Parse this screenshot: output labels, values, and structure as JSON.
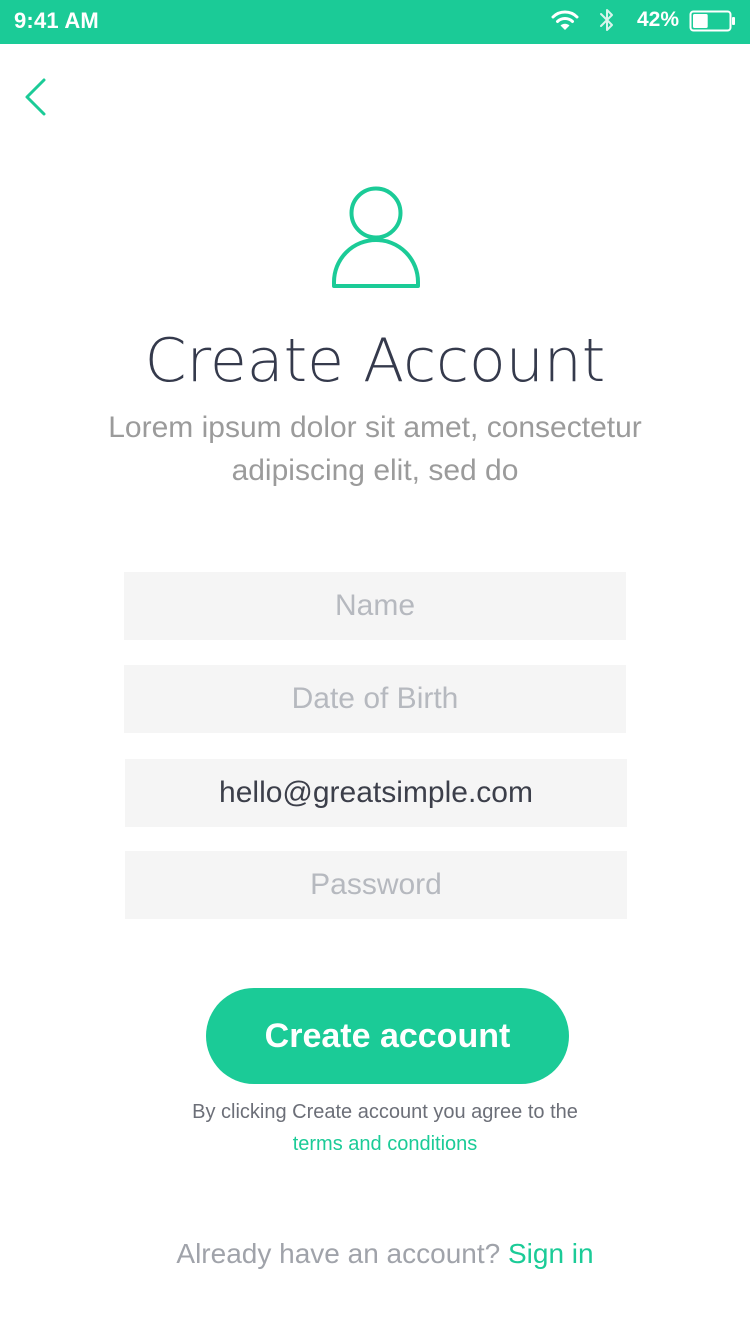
{
  "status_bar": {
    "time": "9:41 AM",
    "battery_percent": "42%",
    "battery_level": 0.42,
    "icons": [
      "wifi-icon",
      "bluetooth-icon",
      "battery-icon"
    ],
    "background_color": "#1bcb97"
  },
  "header": {
    "back_icon": "chevron-left-icon"
  },
  "hero": {
    "icon": "user-icon",
    "title": "Create Account",
    "subtitle": "Lorem ipsum dolor sit amet, consectetur adipiscing elit, sed do"
  },
  "form": {
    "name": {
      "placeholder": "Name",
      "value": ""
    },
    "date_of_birth": {
      "placeholder": "Date of Birth",
      "value": ""
    },
    "email": {
      "placeholder": "",
      "value": "hello@greatsimple.com"
    },
    "password": {
      "placeholder": "Password",
      "value": ""
    }
  },
  "actions": {
    "create_label": "Create account",
    "agree_text": "By clicking Create account you agree to the",
    "terms_label": "terms and conditions"
  },
  "footer": {
    "prompt": "Already have an account?",
    "signin_label": "Sign in"
  },
  "colors": {
    "accent": "#1bcb97",
    "title": "#353a4c",
    "muted": "#9b9b9b",
    "field_bg": "#f5f5f5"
  }
}
